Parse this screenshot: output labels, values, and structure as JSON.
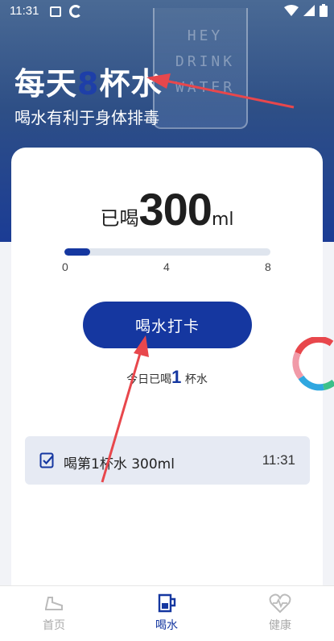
{
  "status": {
    "time": "11:31"
  },
  "hero": {
    "title_prefix": "每天",
    "title_number": "8",
    "title_suffix": "杯水",
    "subtitle": "喝水有利于身体排毒",
    "glass_text": [
      "HEY",
      "DRINK",
      "WATER"
    ]
  },
  "intake": {
    "label": "已喝",
    "amount": "300",
    "unit": "ml",
    "progress_fraction": 0.125,
    "ticks": [
      "0",
      "4",
      "8"
    ]
  },
  "checkin_button": {
    "label": "喝水打卡"
  },
  "today": {
    "prefix": "今日已喝",
    "count": "1",
    "suffix": "杯水"
  },
  "records": [
    {
      "label": "喝第1杯水 300ml",
      "time": "11:31"
    }
  ],
  "tabs": [
    {
      "label": "首页",
      "icon": "shoe-icon"
    },
    {
      "label": "喝水",
      "icon": "cup-icon"
    },
    {
      "label": "健康",
      "icon": "heart-pulse-icon"
    }
  ],
  "colors": {
    "accent": "#1537a0",
    "hero": "#1b3c95",
    "card_bg": "#ffffff",
    "record_bg": "#e6eaf3",
    "annotation": "#e8474c"
  }
}
